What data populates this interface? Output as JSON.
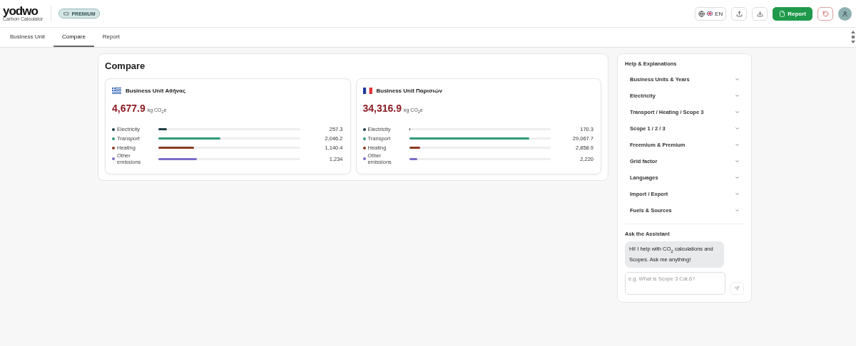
{
  "header": {
    "logo": "yodwo",
    "subtitle": "Carbon Calculator",
    "badge": "PREMIUM",
    "language": "EN",
    "report_button": "Report"
  },
  "tabs": [
    {
      "label": "Business Unit",
      "selected": false
    },
    {
      "label": "Compare",
      "selected": true
    },
    {
      "label": "Report",
      "selected": false
    }
  ],
  "compare": {
    "title": "Compare",
    "units": [
      {
        "kind": "greece",
        "name": "Business Unit Αθήνας",
        "total": "4,677.9",
        "unit": "kg CO$_{2}$e",
        "rows": [
          {
            "label": "Electricity",
            "color": "#1f3d47",
            "level": 0.06,
            "value": "257.3"
          },
          {
            "label": "Transport",
            "color": "#2e9a78",
            "level": 0.44,
            "value": "2,046.2"
          },
          {
            "label": "Heating",
            "color": "#8b3a22",
            "level": 0.25,
            "value": "1,140.4"
          },
          {
            "label": "Other emissions",
            "color": "#7b6cc9",
            "level": 0.27,
            "value": "1,234"
          }
        ]
      },
      {
        "kind": "france",
        "name": "Business Unit Παρισιών",
        "total": "34,316.9",
        "unit": "kg CO$_{2}$e",
        "rows": [
          {
            "label": "Electricity",
            "color": "#1f3d47",
            "level": 0.01,
            "value": "170.3"
          },
          {
            "label": "Transport",
            "color": "#2e9a78",
            "level": 0.85,
            "value": "29,067.7"
          },
          {
            "label": "Heating",
            "color": "#8b3a22",
            "level": 0.08,
            "value": "2,858.9"
          },
          {
            "label": "Other emissions",
            "color": "#7b6cc9",
            "level": 0.06,
            "value": "2,220"
          }
        ]
      }
    ]
  },
  "help": {
    "title": "Help & Explanations",
    "items": [
      {
        "label": "Business Units & Years",
        "expanded": false
      },
      {
        "label": "Electricity",
        "expanded": false
      },
      {
        "label": "Transport / Heating / Scope 3",
        "expanded": false
      },
      {
        "label": "Scope 1 / 2 / 3",
        "expanded": false
      },
      {
        "label": "Freemium & Premium",
        "expanded": false
      },
      {
        "label": "Grid factor",
        "expanded": false
      },
      {
        "label": "Languages",
        "expanded": false
      },
      {
        "label": "Import / Export",
        "expanded": false
      },
      {
        "label": "Fuels & Sources",
        "expanded": false
      }
    ],
    "assistant_title": "Ask the Assistant",
    "message": "Hi! I help with CO$_{2}$ calculations and Scopes. Ask me anything!",
    "placeholder": "e.g. What is Scope 3 Cat.6?"
  }
}
